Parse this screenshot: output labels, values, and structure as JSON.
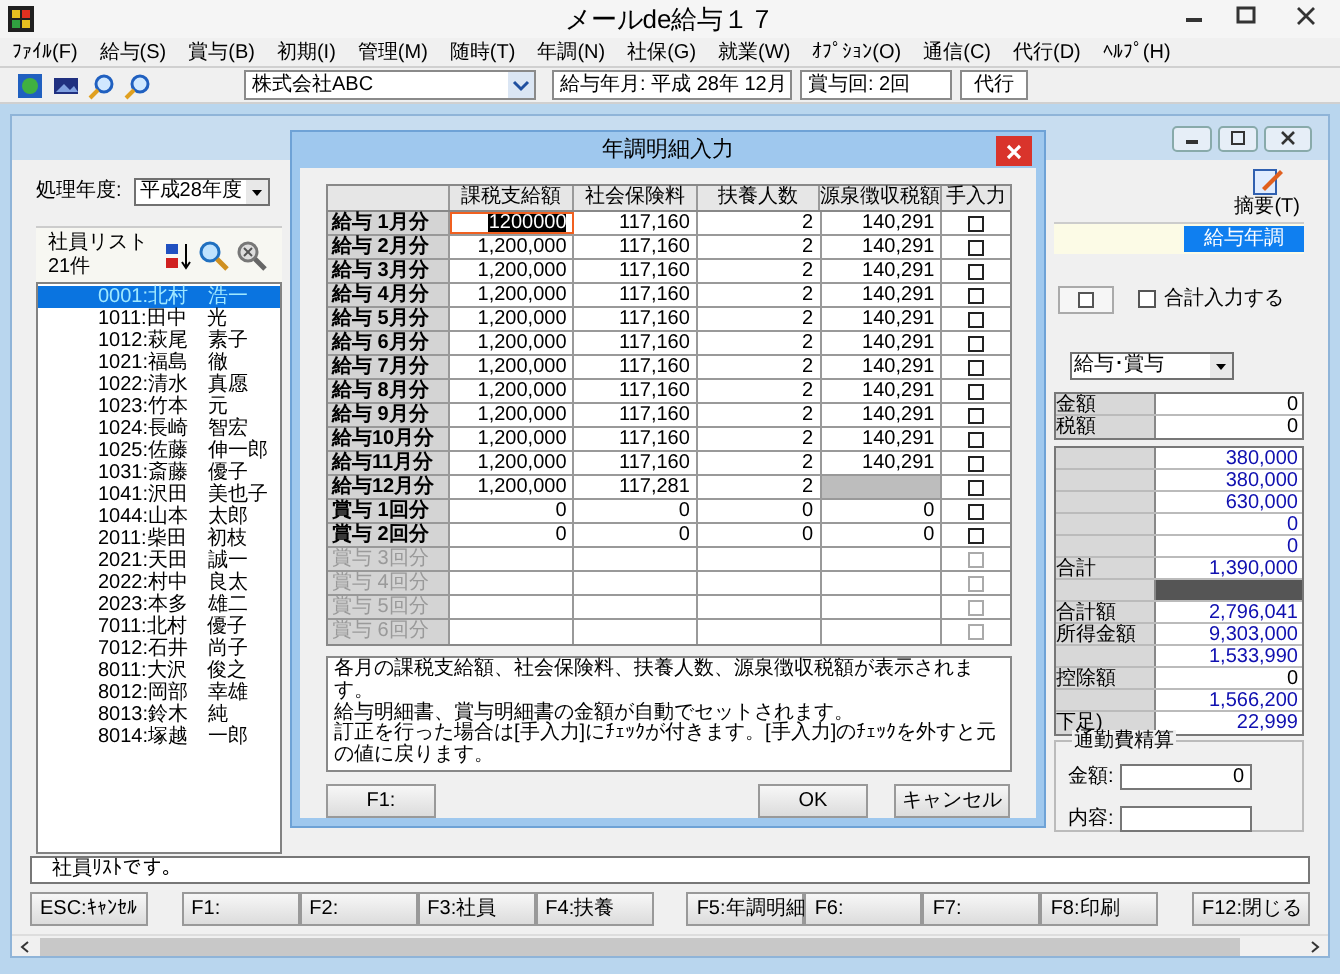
{
  "app": {
    "title": "メールde給与１７"
  },
  "menu": [
    "ﾌｧｲﾙ(F)",
    "給与(S)",
    "賞与(B)",
    "初期(I)",
    "管理(M)",
    "随時(T)",
    "年調(N)",
    "社保(G)",
    "就業(W)",
    "ｵﾌﾟｼｮﾝ(O)",
    "通信(C)",
    "代行(D)",
    "ﾍﾙﾌﾟ(H)"
  ],
  "toolbar": {
    "company": "株式会社ABC",
    "pay_month": "給与年月: 平成 28年 12月",
    "bonus_round": "賞与回: 2回",
    "proxy_button": "代行"
  },
  "left_panel": {
    "year_label": "処理年度:",
    "year_value": "平成28年度",
    "list_title": "社員リスト",
    "list_count": "21件",
    "employees": [
      {
        "name": "0001:北村　浩一",
        "selected": true
      },
      {
        "name": "1011:田中　光",
        "selected": false
      },
      {
        "name": "1012:萩尾　素子",
        "selected": false
      },
      {
        "name": "1021:福島　徹",
        "selected": false
      },
      {
        "name": "1022:清水　真愿",
        "selected": false
      },
      {
        "name": "1023:竹本　元",
        "selected": false
      },
      {
        "name": "1024:長崎　智宏",
        "selected": false
      },
      {
        "name": "1025:佐藤　伸一郎",
        "selected": false
      },
      {
        "name": "1031:斎藤　優子",
        "selected": false
      },
      {
        "name": "1041:沢田　美也子",
        "selected": false
      },
      {
        "name": "1044:山本　太郎",
        "selected": false
      },
      {
        "name": "2011:柴田　初枝",
        "selected": false
      },
      {
        "name": "2021:天田　誠一",
        "selected": false
      },
      {
        "name": "2022:村中　良太",
        "selected": false
      },
      {
        "name": "2023:本多　雄二",
        "selected": false
      },
      {
        "name": "7011:北村　優子",
        "selected": false
      },
      {
        "name": "7012:石井　尚子",
        "selected": false
      },
      {
        "name": "8011:大沢　俊之",
        "selected": false
      },
      {
        "name": "8012:岡部　幸雄",
        "selected": false
      },
      {
        "name": "8013:鈴木　純",
        "selected": false
      },
      {
        "name": "8014:塚越　一郎",
        "selected": false
      }
    ]
  },
  "right_panel": {
    "summary_button": "摘要(T)",
    "mode_badge": "給与年調",
    "total_input": {
      "label": "合計入力する",
      "checked": false
    },
    "category": "給与･賞与",
    "groups": [
      [
        {
          "label": "金額",
          "value": "0",
          "computed": false
        },
        {
          "label": "税額",
          "value": "0",
          "computed": false
        }
      ],
      [
        {
          "value": "380,000",
          "computed": true
        },
        {
          "value": "380,000",
          "computed": true
        },
        {
          "value": "630,000",
          "computed": true
        },
        {
          "value": "0",
          "computed": true
        },
        {
          "value": "0",
          "computed": true
        },
        {
          "label": "合計",
          "value": "1,390,000",
          "computed": true
        },
        {
          "kind": "shaded"
        },
        {
          "label": "合計額",
          "value": "2,796,041",
          "computed": true
        },
        {
          "label": "所得金額",
          "value": "9,303,000",
          "computed": true
        },
        {
          "value": "1,533,990",
          "computed": true
        },
        {
          "label": "控除額",
          "value": "0",
          "computed": false
        },
        {
          "value": "1,566,200",
          "computed": true
        },
        {
          "label": "下足)",
          "value": "22,999",
          "computed": true
        }
      ]
    ],
    "commute": {
      "title": "通勤費精算",
      "amount_label": "金額:",
      "amount": "0",
      "memo_label": "内容:"
    }
  },
  "status": "社員ﾘｽﾄです。",
  "function_keys": [
    [
      "ESC:ｷｬﾝｾﾙ"
    ],
    [
      "F1:",
      "F2:",
      "F3:社員",
      "F4:扶養"
    ],
    [
      "F5:年調明細",
      "F6:",
      "F7:",
      "F8:印刷"
    ],
    [
      "F12:閉じる"
    ]
  ],
  "dialog": {
    "title": "年調明細入力",
    "columns": [
      "課税支給額",
      "社会保険料",
      "扶養人数",
      "源泉徴収税額",
      "手入力"
    ],
    "rows": [
      {
        "label": "給与 1月分",
        "values": [
          "1200000",
          "117,160",
          "2",
          "140,291"
        ],
        "editing": true,
        "manual": false,
        "disabled": false,
        "tax_locked": false
      },
      {
        "label": "給与 2月分",
        "values": [
          "1,200,000",
          "117,160",
          "2",
          "140,291"
        ],
        "editing": false,
        "manual": false,
        "disabled": false,
        "tax_locked": false
      },
      {
        "label": "給与 3月分",
        "values": [
          "1,200,000",
          "117,160",
          "2",
          "140,291"
        ],
        "editing": false,
        "manual": false,
        "disabled": false,
        "tax_locked": false
      },
      {
        "label": "給与 4月分",
        "values": [
          "1,200,000",
          "117,160",
          "2",
          "140,291"
        ],
        "editing": false,
        "manual": false,
        "disabled": false,
        "tax_locked": false
      },
      {
        "label": "給与 5月分",
        "values": [
          "1,200,000",
          "117,160",
          "2",
          "140,291"
        ],
        "editing": false,
        "manual": false,
        "disabled": false,
        "tax_locked": false
      },
      {
        "label": "給与 6月分",
        "values": [
          "1,200,000",
          "117,160",
          "2",
          "140,291"
        ],
        "editing": false,
        "manual": false,
        "disabled": false,
        "tax_locked": false
      },
      {
        "label": "給与 7月分",
        "values": [
          "1,200,000",
          "117,160",
          "2",
          "140,291"
        ],
        "editing": false,
        "manual": false,
        "disabled": false,
        "tax_locked": false
      },
      {
        "label": "給与 8月分",
        "values": [
          "1,200,000",
          "117,160",
          "2",
          "140,291"
        ],
        "editing": false,
        "manual": false,
        "disabled": false,
        "tax_locked": false
      },
      {
        "label": "給与 9月分",
        "values": [
          "1,200,000",
          "117,160",
          "2",
          "140,291"
        ],
        "editing": false,
        "manual": false,
        "disabled": false,
        "tax_locked": false
      },
      {
        "label": "給与10月分",
        "values": [
          "1,200,000",
          "117,160",
          "2",
          "140,291"
        ],
        "editing": false,
        "manual": false,
        "disabled": false,
        "tax_locked": false
      },
      {
        "label": "給与11月分",
        "values": [
          "1,200,000",
          "117,160",
          "2",
          "140,291"
        ],
        "editing": false,
        "manual": false,
        "disabled": false,
        "tax_locked": false
      },
      {
        "label": "給与12月分",
        "values": [
          "1,200,000",
          "117,281",
          "2"
        ],
        "editing": false,
        "manual": false,
        "disabled": false,
        "tax_locked": true
      },
      {
        "label": "賞与 1回分",
        "values": [
          "0",
          "0",
          "0",
          "0"
        ],
        "editing": false,
        "manual": false,
        "disabled": false,
        "tax_locked": false
      },
      {
        "label": "賞与 2回分",
        "values": [
          "0",
          "0",
          "0",
          "0"
        ],
        "editing": false,
        "manual": false,
        "disabled": false,
        "tax_locked": false
      },
      {
        "label": "賞与 3回分",
        "manual": false,
        "disabled": true,
        "tax_locked": false
      },
      {
        "label": "賞与 4回分",
        "manual": false,
        "disabled": true,
        "tax_locked": false
      },
      {
        "label": "賞与 5回分",
        "manual": false,
        "disabled": true,
        "tax_locked": false
      },
      {
        "label": "賞与 6回分",
        "manual": false,
        "disabled": true,
        "tax_locked": false
      }
    ],
    "note_lines": [
      "各月の課税支給額、社会保険料、扶養人数、源泉徴収税額が表示されます。",
      "給与明細書、賞与明細書の金額が自動でセットされます。",
      "訂正を行った場合は[手入力]にﾁｪｯｸが付きます。[手入力]のﾁｪｯｸを外すと元の値に戻ります。"
    ],
    "buttons": {
      "help": "F1:",
      "ok": "OK",
      "cancel": "キャンセル"
    }
  }
}
